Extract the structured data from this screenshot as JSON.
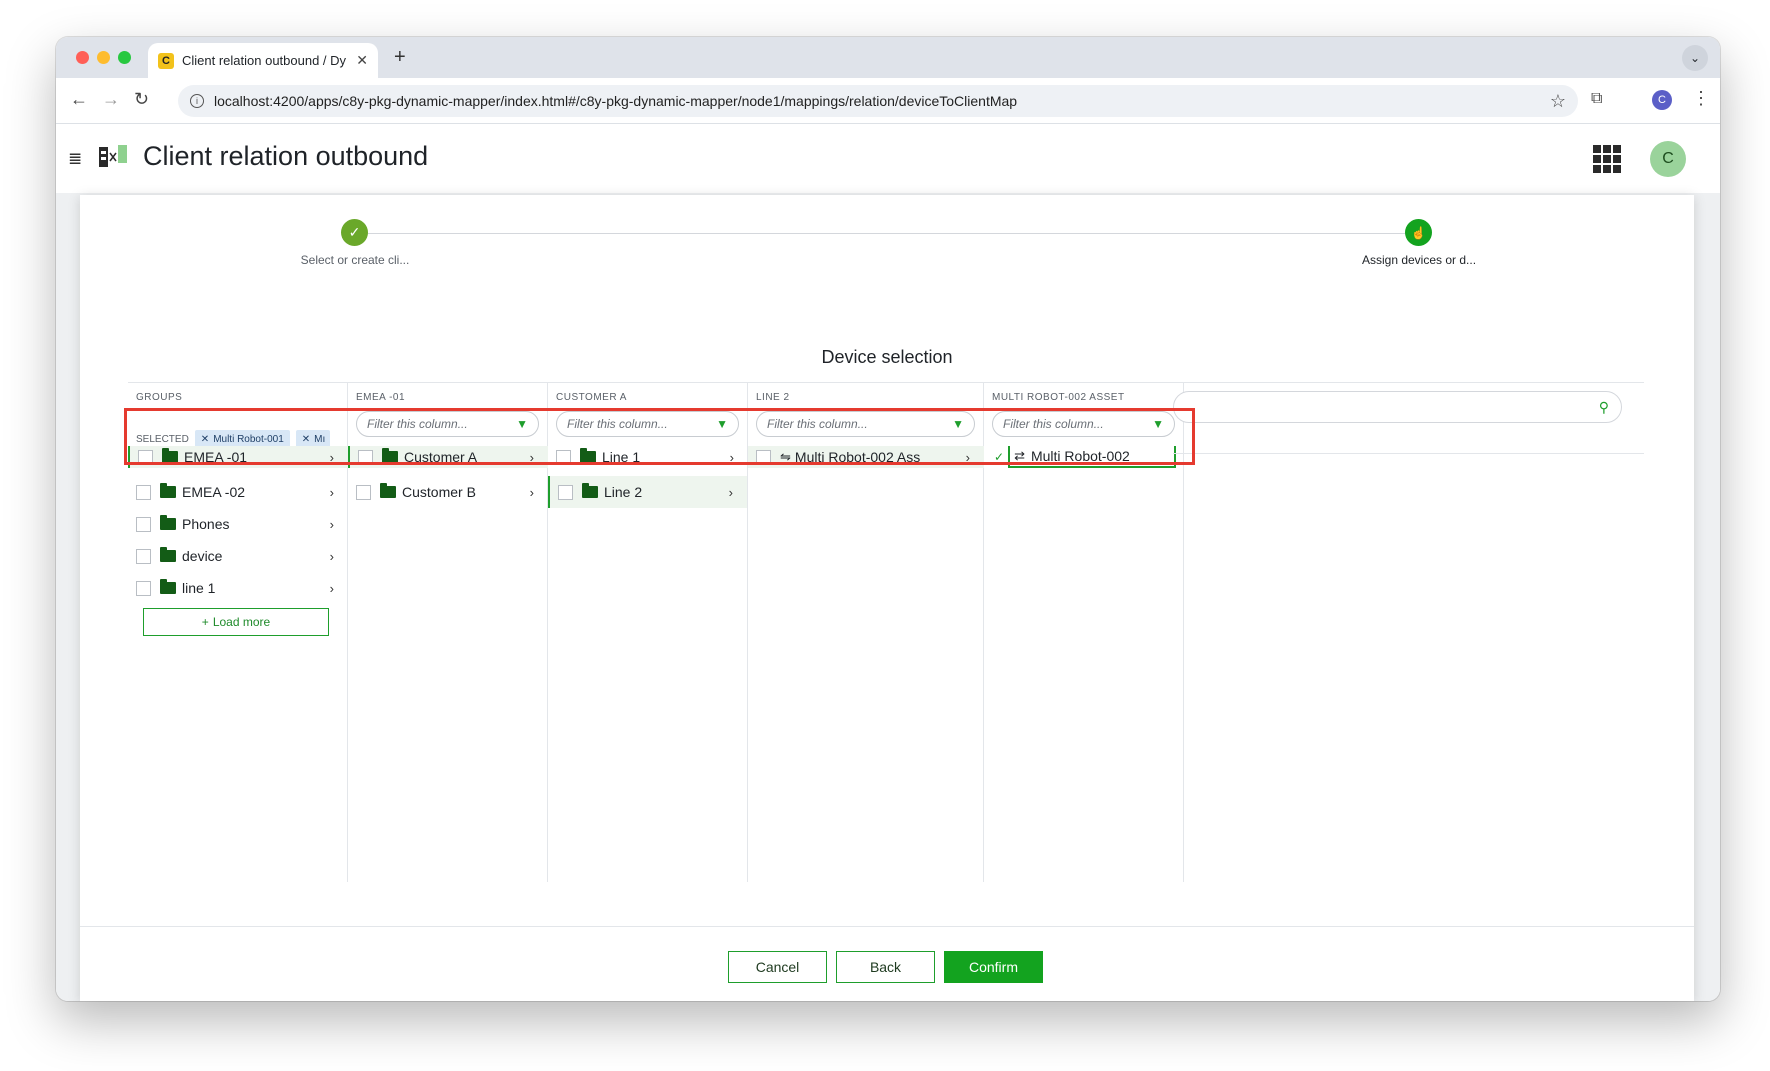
{
  "browser": {
    "tab_title": "Client relation outbound / Dy",
    "favicon_letter": "C",
    "url": "localhost:4200/apps/c8y-pkg-dynamic-mapper/index.html#/c8y-pkg-dynamic-mapper/node1/mappings/relation/deviceToClientMap",
    "profile_initial": "C"
  },
  "app": {
    "title": "Client relation outbound",
    "avatar_initial": "C"
  },
  "stepper": {
    "steps": [
      {
        "label": "Select or create cli...",
        "status": "done"
      },
      {
        "label": "Assign devices or d...",
        "status": "active"
      }
    ]
  },
  "section_title": "Device selection",
  "columns": [
    {
      "header": "GROUPS",
      "filter_placeholder": "",
      "items": [
        "EMEA -01",
        "EMEA -02",
        "Phones",
        "device",
        "line 1"
      ],
      "load_more": "Load more"
    },
    {
      "header": "EMEA -01",
      "filter_placeholder": "Filter this column...",
      "items": [
        "Customer A",
        "Customer B"
      ]
    },
    {
      "header": "CUSTOMER A",
      "filter_placeholder": "Filter this column...",
      "items": [
        "Line 1",
        "Line 2"
      ]
    },
    {
      "header": "LINE 2",
      "filter_placeholder": "Filter this column...",
      "items": [
        "Multi Robot-002 Ass"
      ]
    },
    {
      "header": "MULTI ROBOT-002 ASSET",
      "filter_placeholder": "Filter this column...",
      "items": [
        "Multi Robot-002"
      ]
    }
  ],
  "selected": {
    "label": "SELECTED",
    "chips": [
      "Multi Robot-001",
      "Mı"
    ]
  },
  "footer": {
    "cancel": "Cancel",
    "back": "Back",
    "confirm": "Confirm"
  },
  "colors": {
    "accent": "#1e9e2c",
    "highlight_box": "#e53a2f",
    "chip_bg": "#d8e7f6"
  }
}
